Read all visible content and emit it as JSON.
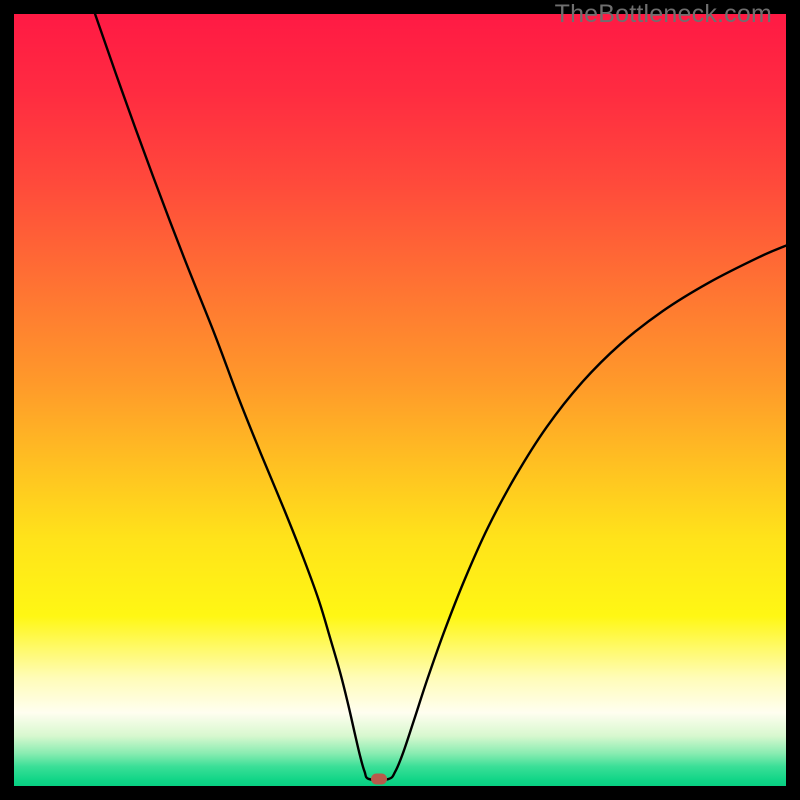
{
  "watermark": "TheBottleneck.com",
  "chart_data": {
    "type": "line",
    "title": "",
    "xlabel": "",
    "ylabel": "",
    "xlim": [
      0,
      100
    ],
    "ylim": [
      0,
      100
    ],
    "grid": false,
    "legend": false,
    "background": {
      "gradient_stops": [
        {
          "pos": 0.0,
          "color": "#ff1a44"
        },
        {
          "pos": 0.1,
          "color": "#ff2b41"
        },
        {
          "pos": 0.22,
          "color": "#ff4a3b"
        },
        {
          "pos": 0.35,
          "color": "#ff7233"
        },
        {
          "pos": 0.48,
          "color": "#ff9a2a"
        },
        {
          "pos": 0.58,
          "color": "#ffbf22"
        },
        {
          "pos": 0.68,
          "color": "#ffe31a"
        },
        {
          "pos": 0.78,
          "color": "#fff714"
        },
        {
          "pos": 0.86,
          "color": "#fffcb8"
        },
        {
          "pos": 0.905,
          "color": "#fffef0"
        },
        {
          "pos": 0.935,
          "color": "#d8f8cf"
        },
        {
          "pos": 0.958,
          "color": "#88ecb1"
        },
        {
          "pos": 0.975,
          "color": "#3adf97"
        },
        {
          "pos": 0.992,
          "color": "#11d587"
        },
        {
          "pos": 1.0,
          "color": "#08cf82"
        }
      ]
    },
    "series": [
      {
        "name": "bottleneck-curve",
        "x": [
          10.5,
          14,
          18,
          22,
          26,
          29,
          32,
          35,
          37.5,
          39.5,
          41,
          42.3,
          43.3,
          44.1,
          44.8,
          45.4,
          46,
          48.5,
          49.4,
          50.4,
          51.8,
          53.6,
          55.8,
          58.4,
          61.4,
          65,
          69,
          73.5,
          78.5,
          84,
          90,
          96.5,
          100
        ],
        "y": [
          100,
          90,
          79,
          68.5,
          58.5,
          50.5,
          43,
          35.8,
          29.5,
          24,
          19,
          14.5,
          10.5,
          7,
          4,
          1.9,
          0.9,
          0.9,
          1.9,
          4.3,
          8.5,
          14,
          20.2,
          26.8,
          33.5,
          40.2,
          46.5,
          52.2,
          57.2,
          61.5,
          65.2,
          68.5,
          70
        ]
      }
    ],
    "marker": {
      "x": 47.3,
      "y": 0.9,
      "color": "#b85a4b"
    }
  }
}
